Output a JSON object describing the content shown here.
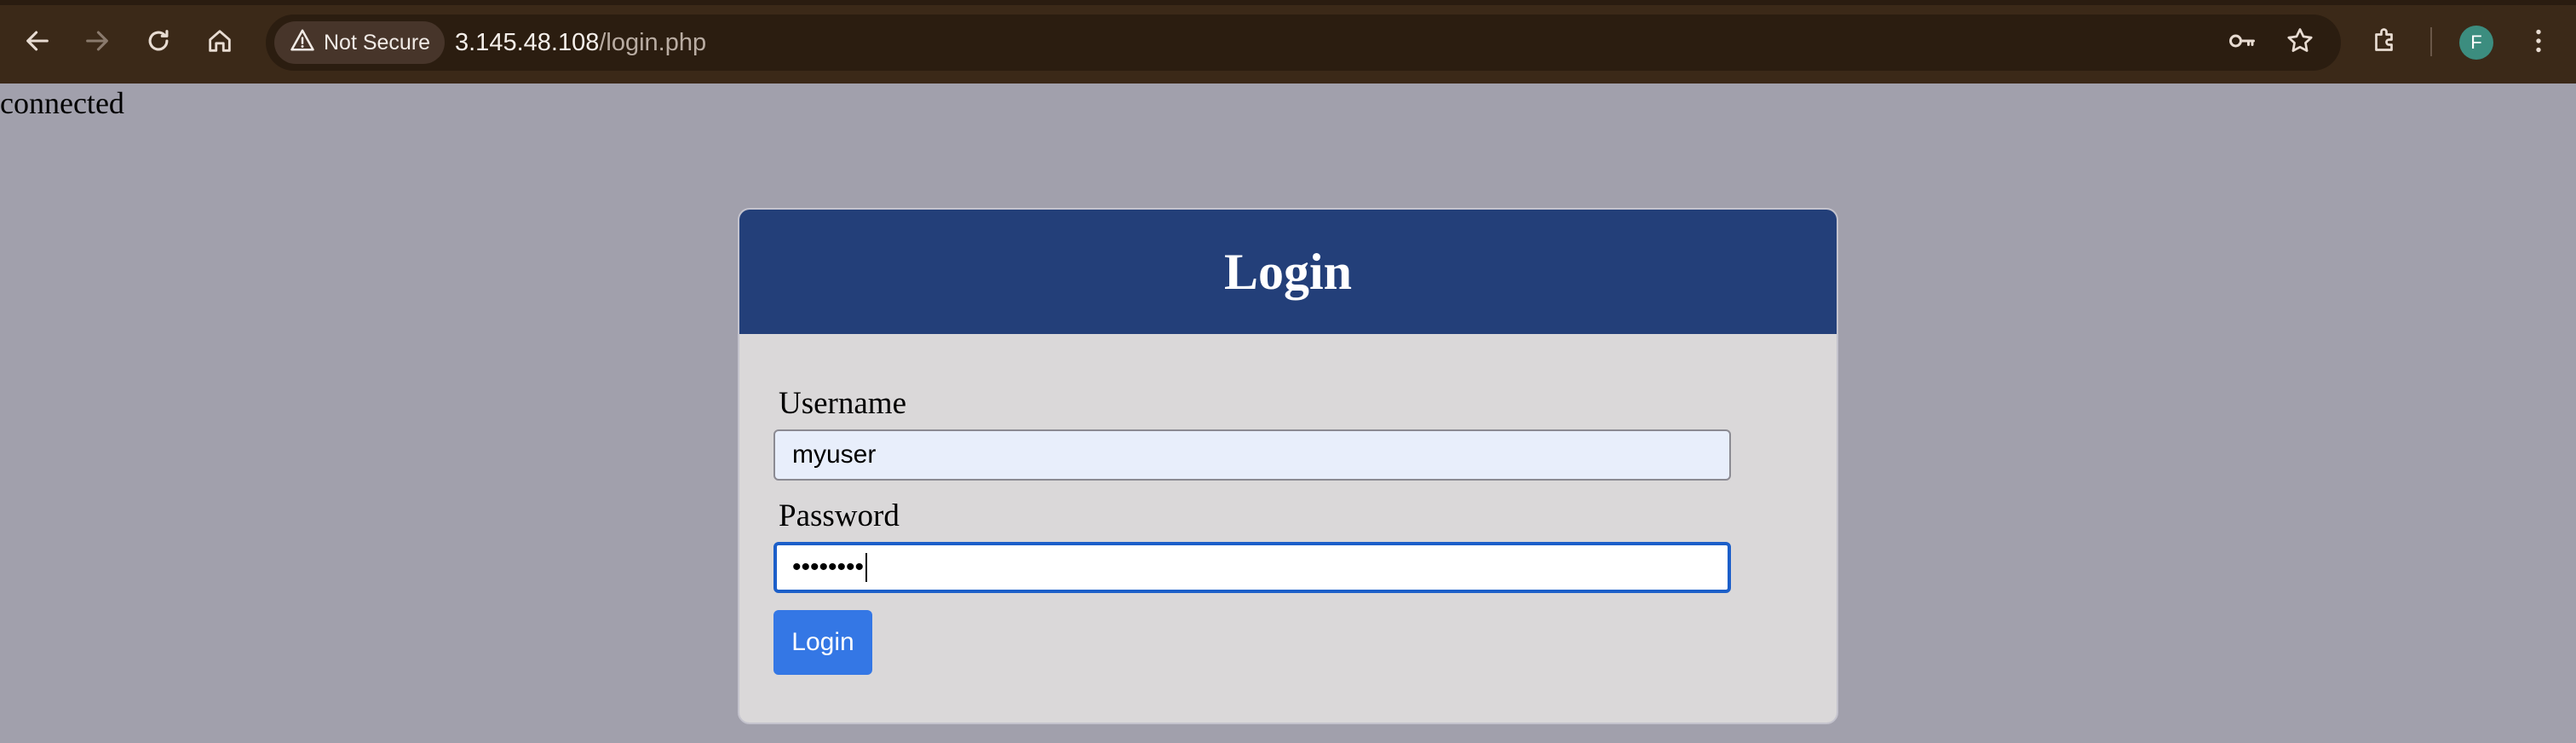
{
  "browser": {
    "security_label": "Not Secure",
    "url_host": "3.145.48.108",
    "url_path": "/login.php",
    "profile_initial": "F"
  },
  "page": {
    "status_text": "connected",
    "login_form": {
      "title": "Login",
      "username_label": "Username",
      "username_value": "myuser",
      "password_label": "Password",
      "password_masked": "••••••••",
      "submit_label": "Login"
    }
  },
  "colors": {
    "page_background": "#a1a0ac",
    "card_header": "#233f79",
    "card_body": "#dad8d9",
    "button": "#3477e5",
    "focus_ring": "#1c5fc9",
    "browser_chrome": "#3b2918"
  },
  "icons": {
    "back": "back-arrow-icon",
    "forward": "forward-arrow-icon",
    "reload": "reload-icon",
    "home": "home-icon",
    "security": "warning-triangle-icon",
    "password_manager": "key-icon",
    "bookmark": "star-icon",
    "extensions": "puzzle-icon",
    "menu": "kebab-menu-icon"
  }
}
